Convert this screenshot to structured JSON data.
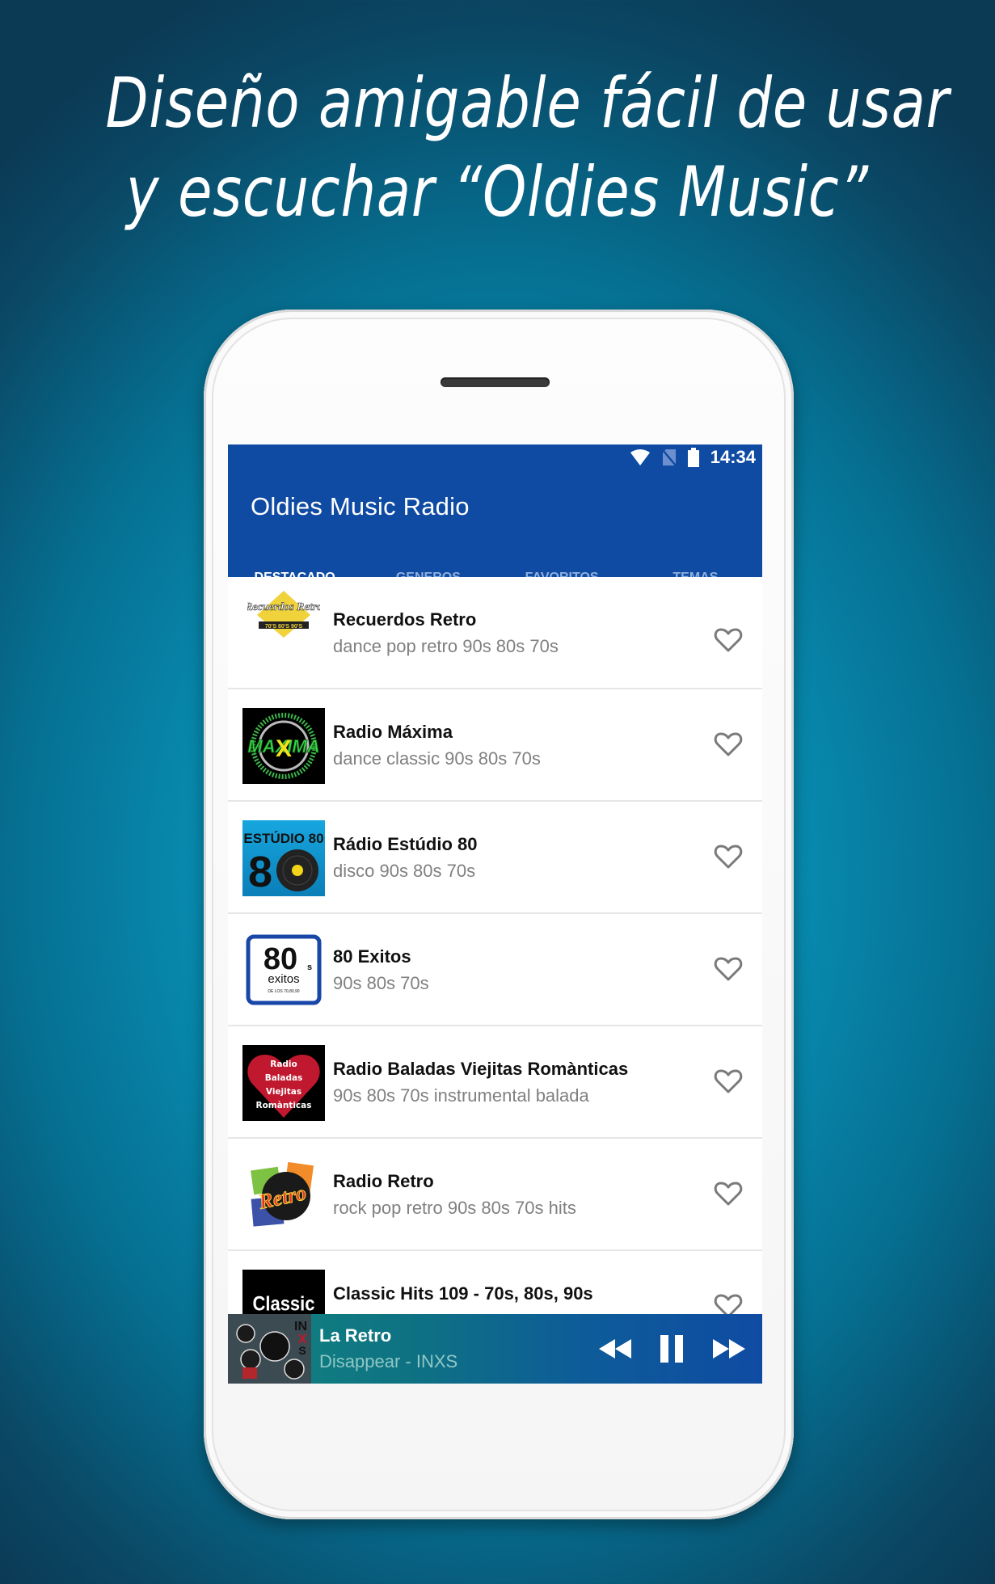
{
  "headline": {
    "line1": "Diseño amigable fácil de usar",
    "line2": "y escuchar  “Oldies Music”"
  },
  "status_bar": {
    "icons": [
      "wifi-icon",
      "no-sim-icon",
      "battery-icon"
    ],
    "time": "14:34"
  },
  "app_bar": {
    "title": "Oldies Music Radio",
    "actions": [
      "search-icon",
      "alarm-icon",
      "more-vert-icon"
    ],
    "color": "#0f4ba3"
  },
  "tabs": [
    {
      "label": "DESTACADO",
      "active": true
    },
    {
      "label": "GENEROS",
      "active": false
    },
    {
      "label": "FAVORITOS",
      "active": false
    },
    {
      "label": "TEMAS",
      "active": false
    }
  ],
  "stations": [
    {
      "name": "Recuerdos Retro",
      "tags": "dance pop retro 90s 80s 70s",
      "logo": "Recuerdos Retro",
      "favorite": false
    },
    {
      "name": "Radio Máxima",
      "tags": "dance classic 90s 80s 70s",
      "logo": "MAXIMA",
      "favorite": false
    },
    {
      "name": "Rádio Estúdio 80",
      "tags": "disco 90s 80s 70s",
      "logo": "ESTÚDIO 80",
      "favorite": false
    },
    {
      "name": "80 Exitos",
      "tags": "90s 80s 70s",
      "logo": "80s exitos",
      "favorite": false
    },
    {
      "name": "Radio Baladas Viejitas Romànticas",
      "tags": "90s 80s 70s instrumental balada",
      "logo": "Radio Baladas Viejitas Romànticas",
      "favorite": false
    },
    {
      "name": "Radio Retro",
      "tags": "rock pop retro 90s 80s 70s hits",
      "logo": "Retro",
      "favorite": false
    },
    {
      "name": "Classic Hits 109 - 70s, 80s, 90s",
      "tags": "",
      "logo": "Classic Hits",
      "favorite": false
    }
  ],
  "player": {
    "station": "La Retro",
    "track": "Disappear - INXS",
    "album_logo": "INXS",
    "controls": [
      "rewind-icon",
      "pause-icon",
      "fast-forward-icon"
    ]
  }
}
